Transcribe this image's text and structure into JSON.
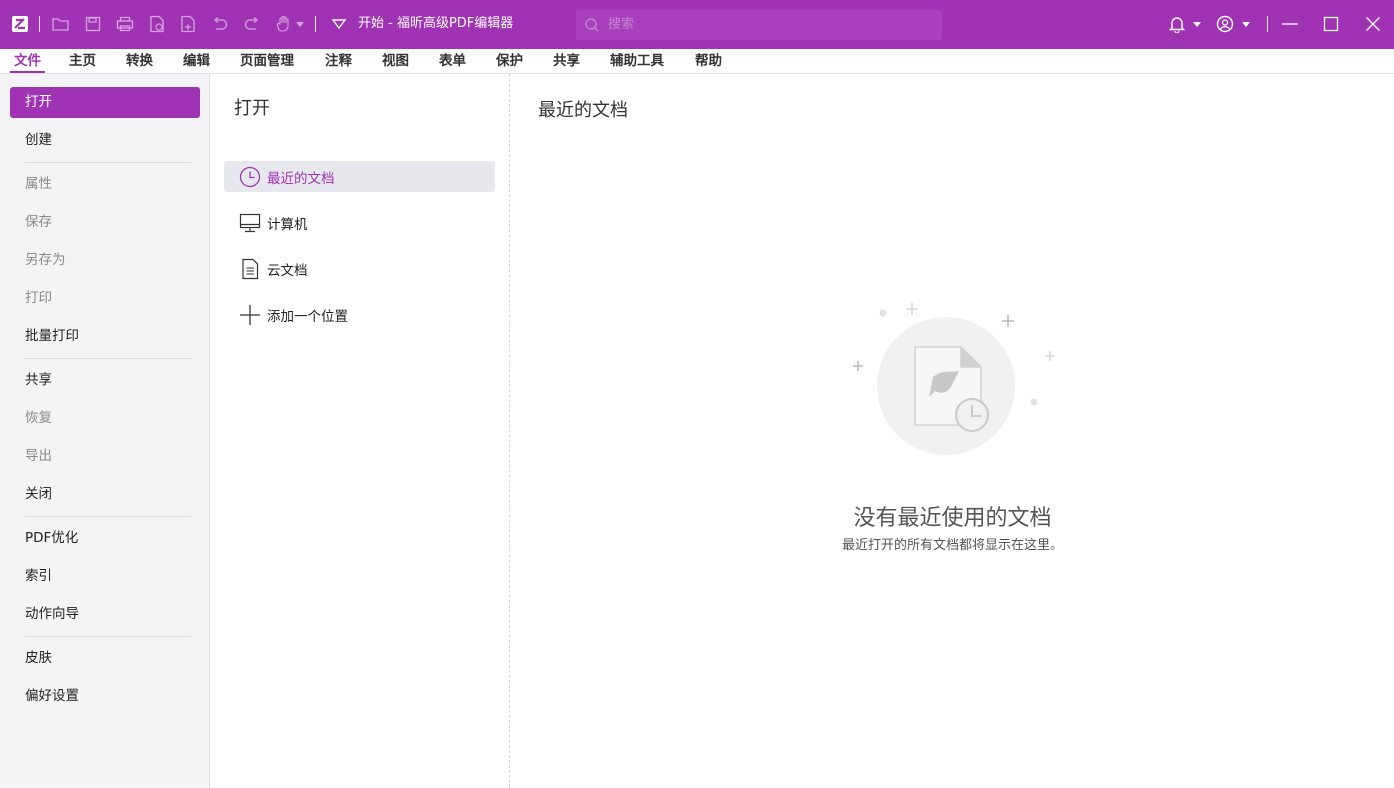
{
  "titlebar": {
    "title": "开始 - 福昕高级PDF编辑器",
    "search_placeholder": "搜索",
    "accent_color": "#a033b4",
    "quick_access_icons": [
      "app-logo-icon",
      "folder-open-icon",
      "save-icon",
      "print-icon",
      "new-doc-icon",
      "export-icon",
      "undo-icon",
      "redo-icon",
      "hand-tool-icon",
      "customize-dropdown-icon"
    ],
    "right_icons": [
      "bell-icon",
      "account-icon",
      "minimize-icon",
      "maximize-icon",
      "close-icon"
    ]
  },
  "menubar": {
    "tabs": [
      {
        "label": "文件",
        "active": true
      },
      {
        "label": "主页"
      },
      {
        "label": "转换"
      },
      {
        "label": "编辑"
      },
      {
        "label": "页面管理"
      },
      {
        "label": "注释"
      },
      {
        "label": "视图"
      },
      {
        "label": "表单"
      },
      {
        "label": "保护"
      },
      {
        "label": "共享"
      },
      {
        "label": "辅助工具"
      },
      {
        "label": "帮助"
      }
    ]
  },
  "sidebar": {
    "items": [
      {
        "label": "打开",
        "state": "active"
      },
      {
        "label": "创建"
      },
      {
        "label": "属性",
        "state": "disabled"
      },
      {
        "label": "保存",
        "state": "disabled"
      },
      {
        "label": "另存为",
        "state": "disabled"
      },
      {
        "label": "打印",
        "state": "disabled"
      },
      {
        "label": "批量打印"
      },
      {
        "label": "共享"
      },
      {
        "label": "恢复",
        "state": "disabled"
      },
      {
        "label": "导出",
        "state": "disabled"
      },
      {
        "label": "关闭"
      },
      {
        "label": "PDF优化"
      },
      {
        "label": "索引"
      },
      {
        "label": "动作向导"
      },
      {
        "label": "皮肤"
      },
      {
        "label": "偏好设置"
      }
    ]
  },
  "open_panel": {
    "title": "打开",
    "items": [
      {
        "label": "最近的文档",
        "icon": "clock-icon",
        "active": true
      },
      {
        "label": "计算机",
        "icon": "monitor-icon"
      },
      {
        "label": "云文档",
        "icon": "document-icon"
      },
      {
        "label": "添加一个位置",
        "icon": "plus-icon"
      }
    ]
  },
  "recent_panel": {
    "title": "最近的文档",
    "empty_title": "没有最近使用的文档",
    "empty_subtitle": "最近打开的所有文档都将显示在这里。"
  }
}
